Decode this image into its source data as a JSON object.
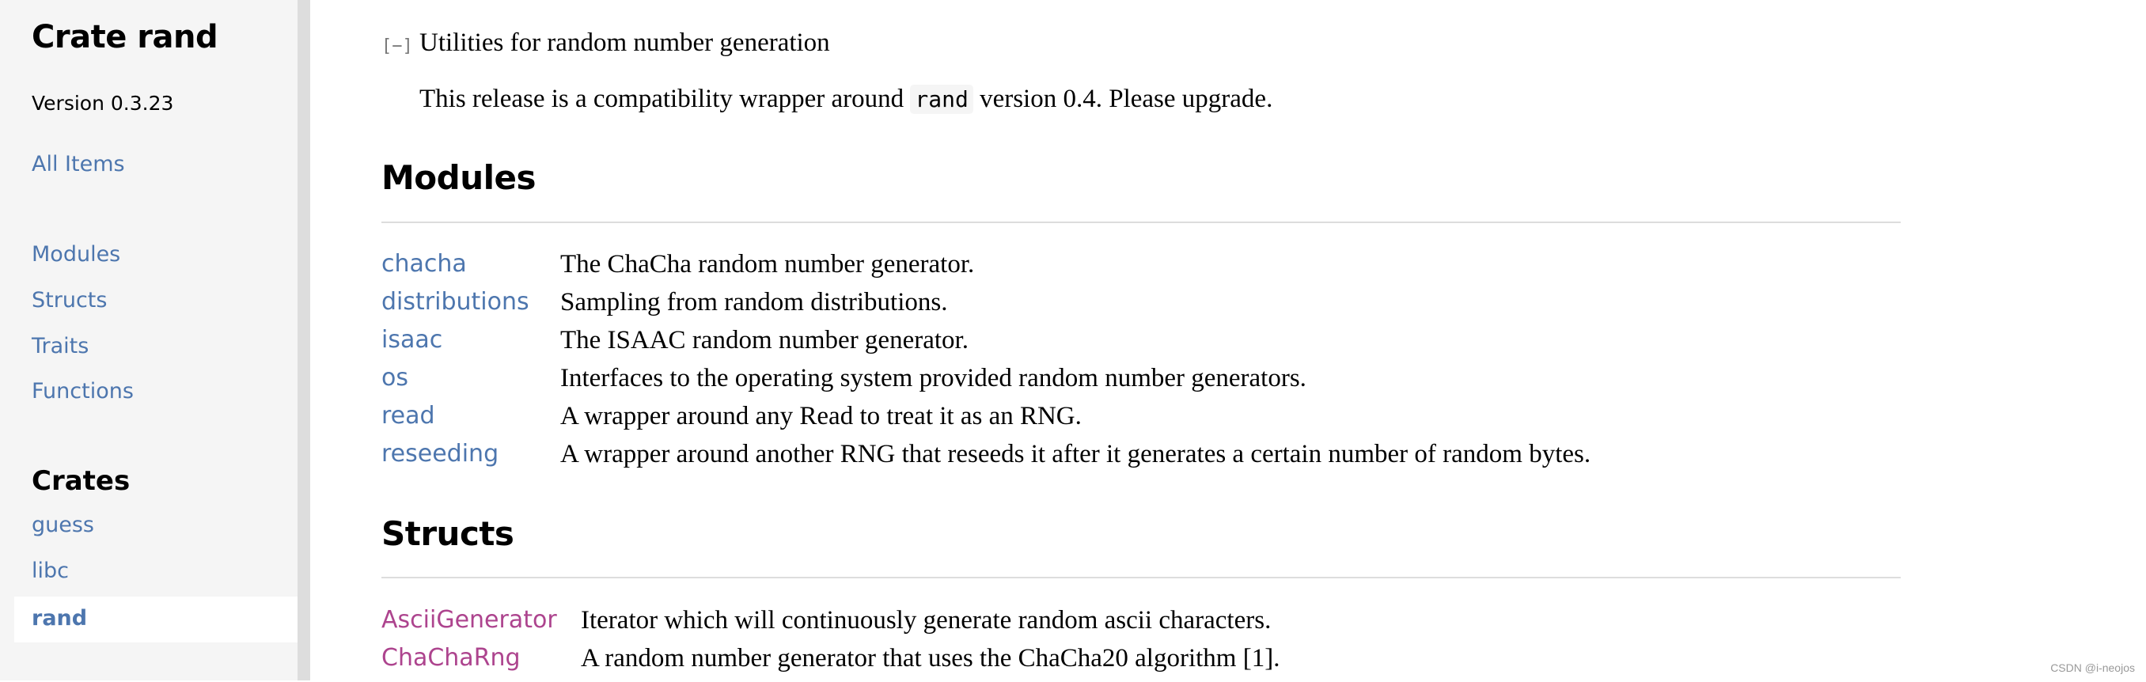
{
  "sidebar": {
    "title": "Crate rand",
    "version": "Version 0.3.23",
    "all_items": "All Items",
    "sections": [
      "Modules",
      "Structs",
      "Traits",
      "Functions"
    ],
    "crates_heading": "Crates",
    "crates": [
      "guess",
      "libc",
      "rand"
    ],
    "current_crate": "rand"
  },
  "main": {
    "toggle_label": "[−]",
    "summary": "Utilities for random number generation",
    "description_before": "This release is a compatibility wrapper around ",
    "description_code": "rand",
    "description_after": " version 0.4. Please upgrade.",
    "modules_heading": "Modules",
    "modules": [
      {
        "name": "chacha",
        "desc": "The ChaCha random number generator."
      },
      {
        "name": "distributions",
        "desc": "Sampling from random distributions."
      },
      {
        "name": "isaac",
        "desc": "The ISAAC random number generator."
      },
      {
        "name": "os",
        "desc": "Interfaces to the operating system provided random number generators."
      },
      {
        "name": "read",
        "desc": "A wrapper around any Read to treat it as an RNG."
      },
      {
        "name": "reseeding",
        "desc": "A wrapper around another RNG that reseeds it after it generates a certain number of random bytes."
      }
    ],
    "structs_heading": "Structs",
    "structs": [
      {
        "name": "AsciiGenerator",
        "desc": "Iterator which will continuously generate random ascii characters."
      },
      {
        "name": "ChaChaRng",
        "desc": "A random number generator that uses the ChaCha20 algorithm [1]."
      }
    ]
  },
  "colors": {
    "module_link": "#4d76ae",
    "struct_link": "#ad448e",
    "sidebar_bg": "#f5f5f5"
  },
  "watermark": "CSDN @i-neojos"
}
